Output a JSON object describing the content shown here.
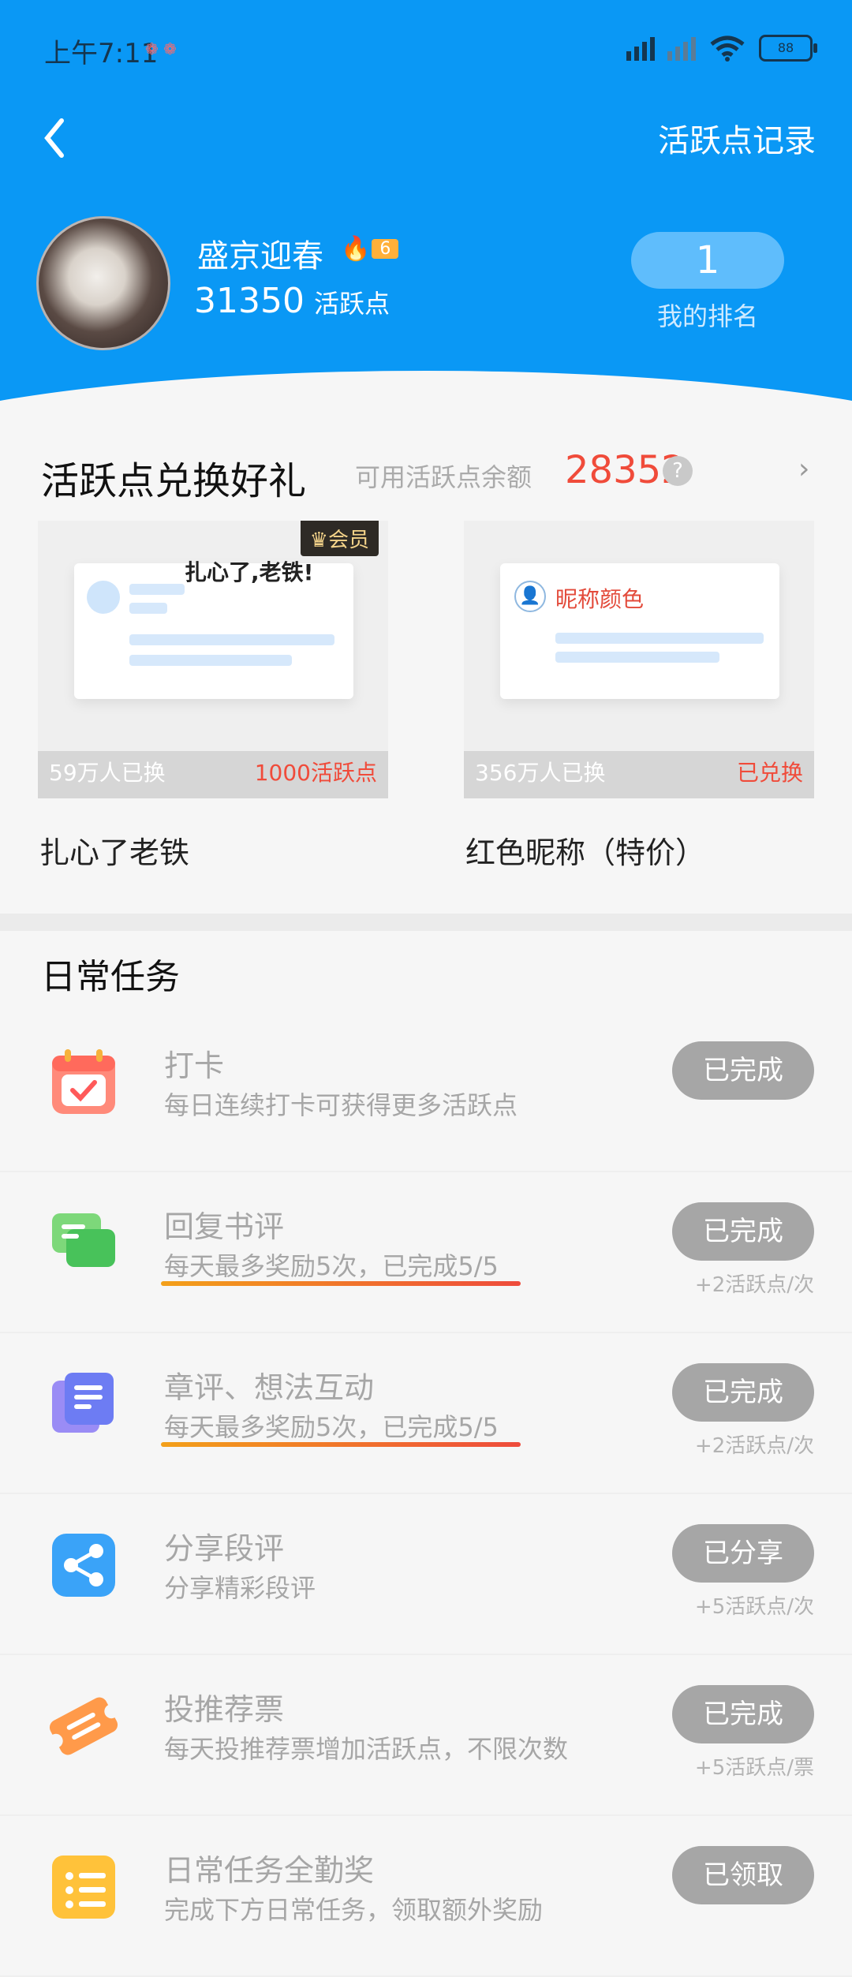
{
  "status": {
    "time": "上午7:11",
    "indicator_dots": "❁ ❁",
    "battery": "88"
  },
  "header": {
    "record_label": "活跃点记录"
  },
  "profile": {
    "name": "盛京迎春",
    "level": "6",
    "points_value": "31350",
    "points_unit": "活跃点",
    "rank_value": "1",
    "rank_label": "我的排名"
  },
  "exchange": {
    "title": "活跃点兑换好礼",
    "balance_label": "可用活跃点余额",
    "balance_value": "28352",
    "help": "?",
    "arrow": "›",
    "cards": [
      {
        "badge": "会员",
        "preview_text": "扎心了,老铁!",
        "exchanged": "59万人已换",
        "price": "1000活跃点",
        "name": "扎心了老铁"
      },
      {
        "preview_text": "昵称颜色",
        "exchanged": "356万人已换",
        "price": "已兑换",
        "name": "红色昵称（特价）"
      }
    ]
  },
  "daily": {
    "title": "日常任务",
    "tasks": [
      {
        "title": "打卡",
        "desc": "每日连续打卡可获得更多活跃点",
        "button": "已完成",
        "reward": ""
      },
      {
        "title": "回复书评",
        "desc": "每天最多奖励5次，已完成5/5",
        "button": "已完成",
        "reward": "+2活跃点/次"
      },
      {
        "title": "章评、想法互动",
        "desc": "每天最多奖励5次，已完成5/5",
        "button": "已完成",
        "reward": "+2活跃点/次"
      },
      {
        "title": "分享段评",
        "desc": "分享精彩段评",
        "button": "已分享",
        "reward": "+5活跃点/次"
      },
      {
        "title": "投推荐票",
        "desc": "每天投推荐票增加活跃点，不限次数",
        "button": "已完成",
        "reward": "+5活跃点/票"
      },
      {
        "title": "日常任务全勤奖",
        "desc": "完成下方日常任务，领取额外奖励",
        "button": "已领取",
        "reward": ""
      }
    ]
  },
  "colors": {
    "header_blue": "#0a98f5",
    "accent_red": "#f04b3a",
    "button_gray": "#a6a6a6"
  }
}
